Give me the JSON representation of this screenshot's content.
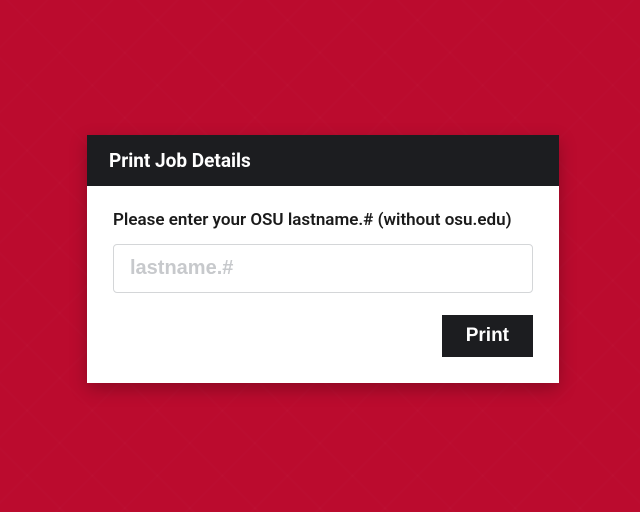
{
  "dialog": {
    "title": "Print Job Details",
    "prompt": "Please enter your OSU lastname.# (without osu.edu)",
    "input": {
      "placeholder": "lastname.#",
      "value": ""
    },
    "print_button_label": "Print"
  },
  "colors": {
    "brand_red": "#bb0b2e",
    "dark": "#1c1d20"
  }
}
